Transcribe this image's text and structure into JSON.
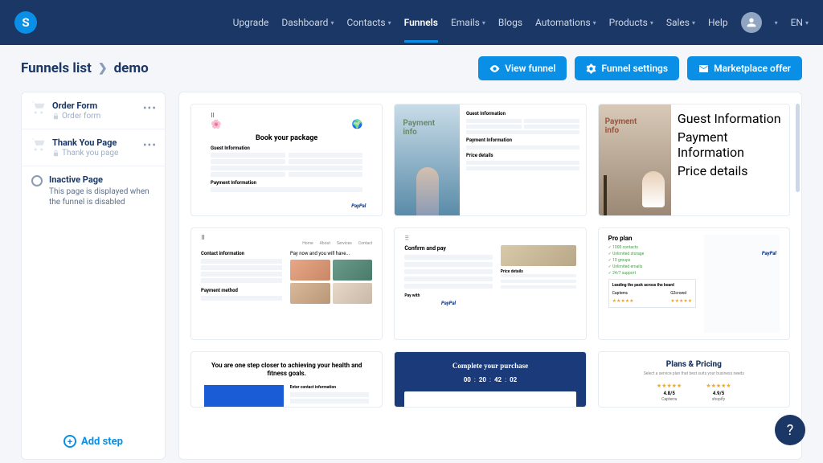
{
  "logo": "S",
  "nav": {
    "upgrade": "Upgrade",
    "dashboard": "Dashboard",
    "contacts": "Contacts",
    "funnels": "Funnels",
    "emails": "Emails",
    "blogs": "Blogs",
    "automations": "Automations",
    "products": "Products",
    "sales": "Sales",
    "help": "Help",
    "lang": "EN"
  },
  "breadcrumb": {
    "root": "Funnels list",
    "current": "demo"
  },
  "actions": {
    "view": "View funnel",
    "settings": "Funnel settings",
    "marketplace": "Marketplace offer"
  },
  "steps": [
    {
      "title": "Order Form",
      "sub": "Order form"
    },
    {
      "title": "Thank You Page",
      "sub": "Thank you page"
    }
  ],
  "inactive": {
    "title": "Inactive Page",
    "desc": "This page is displayed when the funnel is disabled"
  },
  "addStep": "Add step",
  "templates": {
    "t1": {
      "title": "Book your package",
      "sec1": "Guest Information",
      "sec2": "Payment Information",
      "paypal": "PayPal"
    },
    "t2": {
      "label": "Payment\ninfo",
      "h1": "Guest Information",
      "h2": "Payment Information",
      "h3": "Price details"
    },
    "t3": {
      "label": "Payment\ninfo"
    },
    "t4": {
      "nav": [
        "Home",
        "About",
        "Services",
        "Contact"
      ],
      "h1": "Contact information",
      "pay": "Pay now and you will have...",
      "h2": "Payment method"
    },
    "t5": {
      "h": "Confirm and pay",
      "price": "Price details",
      "pay": "Pay with",
      "paypal": "PayPal"
    },
    "t6": {
      "title": "Pro plan",
      "feats": [
        "✓ 1000 contacts",
        "✓ Unlimited storage",
        "✓ 10 groups",
        "✓ Unlimited emails",
        "✓ 24/7 support"
      ],
      "box": "Leading the pack across the board",
      "cap": "Capterra",
      "g2": "G2crowd"
    },
    "t7": {
      "h": "You are one step closer to achieving your health and fitness goals.",
      "fh": "Enter contact information"
    },
    "t8": {
      "h": "Complete your purchase",
      "timer": [
        "00",
        "20",
        "42",
        "02"
      ]
    },
    "t9": {
      "h": "Plans & Pricing",
      "sub": "Select a service plan that best suits your business needs",
      "scores": [
        {
          "score": "4.8/5",
          "src": "Capterra"
        },
        {
          "score": "4.9/5",
          "src": "shopify"
        }
      ]
    }
  },
  "helpIcon": "?"
}
